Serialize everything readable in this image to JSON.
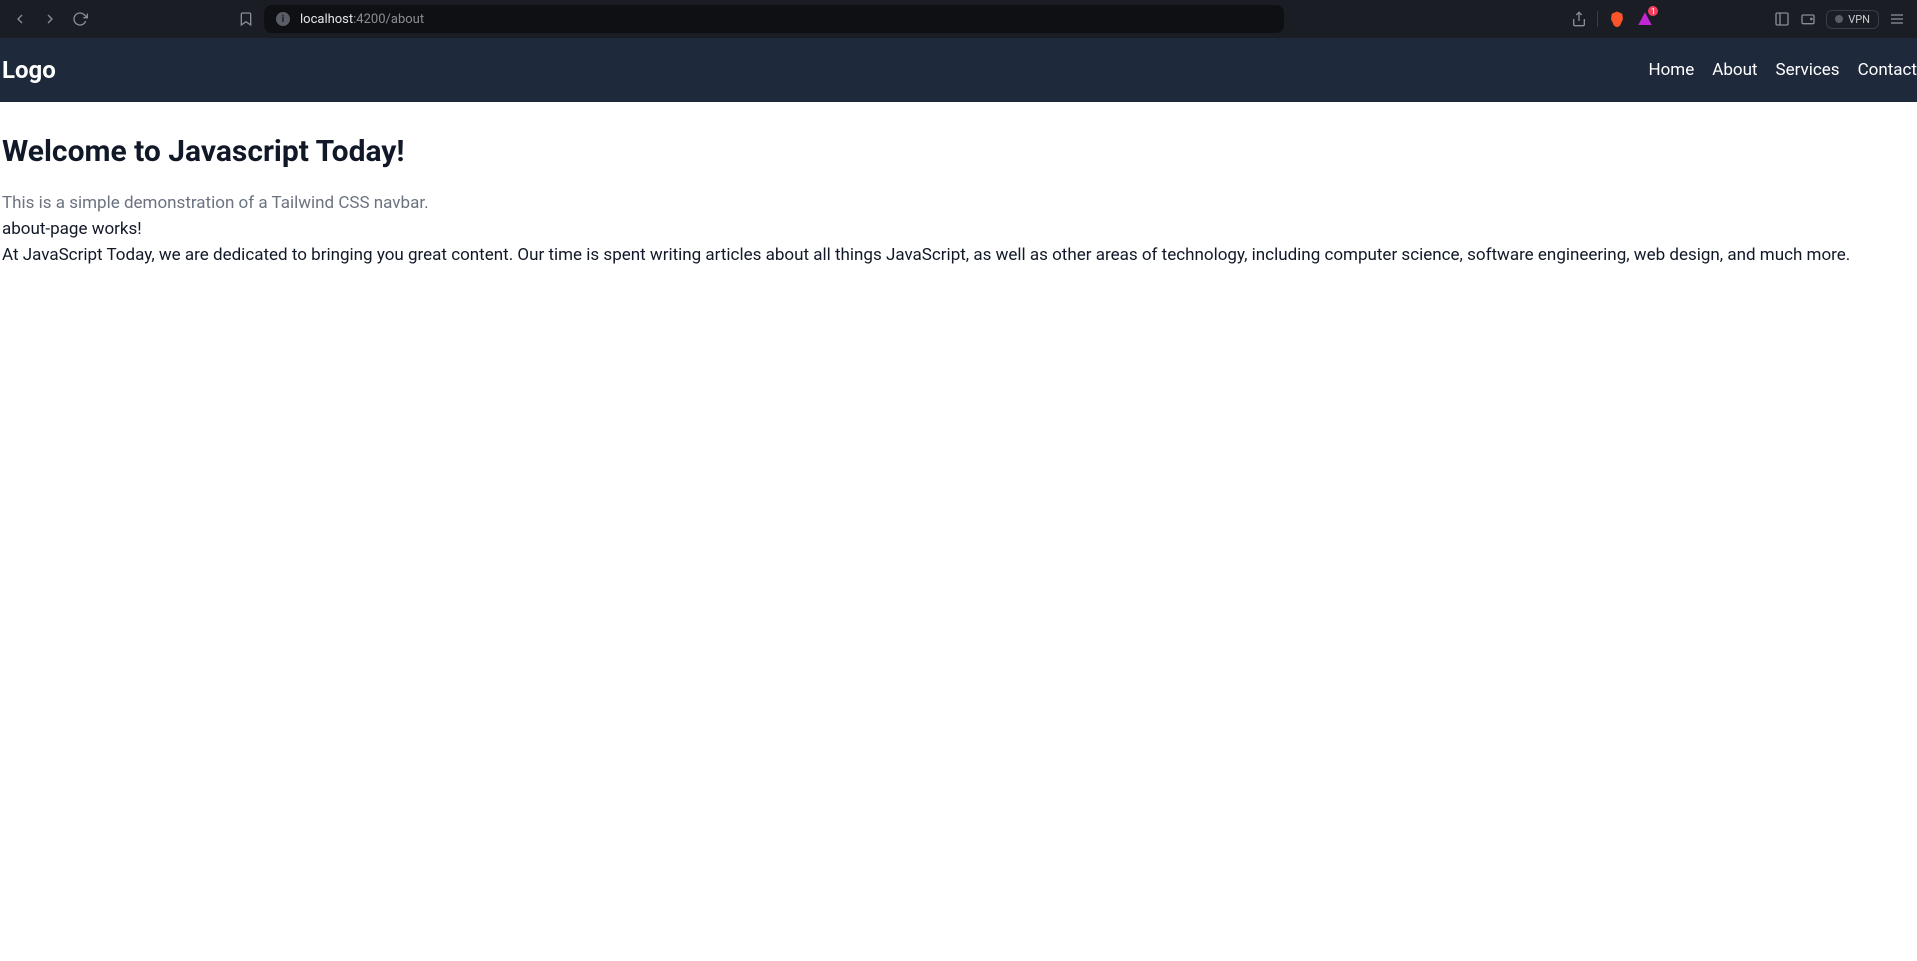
{
  "browser": {
    "url_host": "localhost",
    "url_path": ":4200/about",
    "vpn_label": "VPN",
    "ext_badge": "1"
  },
  "navbar": {
    "logo": "Logo",
    "links": [
      "Home",
      "About",
      "Services",
      "Contact"
    ]
  },
  "page": {
    "heading": "Welcome to Javascript Today!",
    "subtitle": "This is a simple demonstration of a Tailwind CSS navbar.",
    "works_line": "about-page works!",
    "body": "At JavaScript Today, we are dedicated to bringing you great content. Our time is spent writing articles about all things JavaScript, as well as other areas of technology, including computer science, software engineering, web design, and much more."
  }
}
